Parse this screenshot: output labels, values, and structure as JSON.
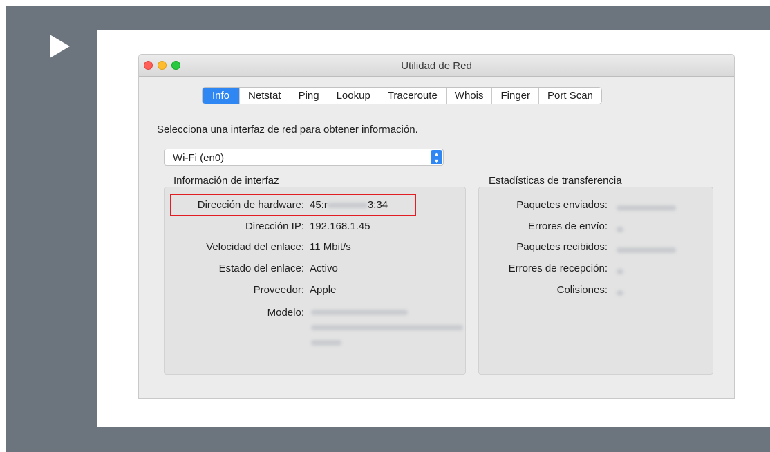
{
  "window": {
    "title": "Utilidad de Red"
  },
  "tabs": [
    {
      "label": "Info",
      "active": true
    },
    {
      "label": "Netstat"
    },
    {
      "label": "Ping"
    },
    {
      "label": "Lookup"
    },
    {
      "label": "Traceroute"
    },
    {
      "label": "Whois"
    },
    {
      "label": "Finger"
    },
    {
      "label": "Port Scan"
    }
  ],
  "prompt": "Selecciona una interfaz de red para obtener información.",
  "interface_select": {
    "value": "Wi-Fi (en0)"
  },
  "interface_info": {
    "title": "Información de interfaz",
    "rows": [
      {
        "label": "Dirección de hardware:",
        "value_start": "45:r",
        "value_end": "3:34",
        "blurred": true
      },
      {
        "label": "Dirección IP:",
        "value": "192.168.1.45"
      },
      {
        "label": "Velocidad del enlace:",
        "value": "11 Mbit/s"
      },
      {
        "label": "Estado del enlace:",
        "value": "Activo"
      },
      {
        "label": "Proveedor:",
        "value": "Apple"
      },
      {
        "label": "Modelo:",
        "value": "",
        "blurred": true
      }
    ]
  },
  "transfer_stats": {
    "title": "Estadísticas de transferencia",
    "rows": [
      {
        "label": "Paquetes enviados:"
      },
      {
        "label": "Errores de envío:"
      },
      {
        "label": "Paquetes recibidos:"
      },
      {
        "label": "Errores de recepción:"
      },
      {
        "label": "Colisiones:"
      }
    ]
  },
  "colors": {
    "accent": "#2f87f3",
    "highlight": "#e21d23",
    "frame": "#6c757e"
  },
  "icons": {
    "play": "play-icon",
    "select_arrows": "updown-chevron-icon"
  }
}
